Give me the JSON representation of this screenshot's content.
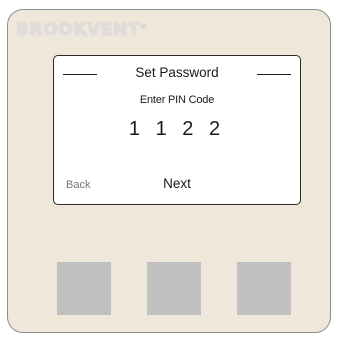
{
  "brand": {
    "name": "BROOKVENT",
    "mark": "®"
  },
  "screen": {
    "title": "Set Password",
    "prompt": "Enter PIN Code",
    "pin": "1 1 2 2",
    "back_label": "Back",
    "next_label": "Next"
  },
  "buttons": [
    {
      "name": "left"
    },
    {
      "name": "middle"
    },
    {
      "name": "right"
    }
  ],
  "colors": {
    "panel": "#efe7d9",
    "button": "#c1c1c1",
    "screen": "#ffffff"
  }
}
